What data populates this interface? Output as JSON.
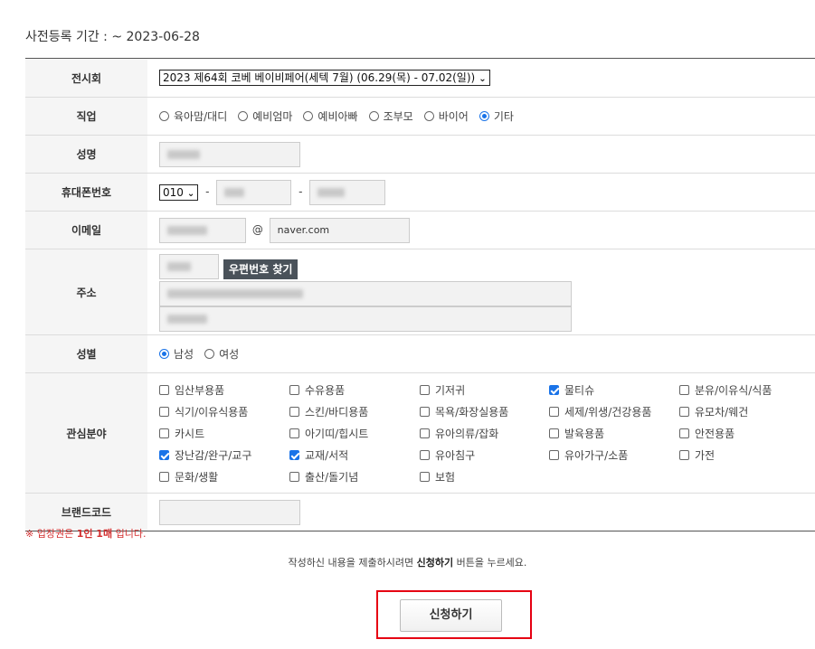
{
  "period": {
    "label": "사전등록 기간 : ~ 2023-06-28"
  },
  "rows": {
    "exhibition": {
      "label": "전시회",
      "value": "2023 제64회 코베 베이비페어(세텍 7월) (06.29(목) - 07.02(일))"
    },
    "job": {
      "label": "직업",
      "options": [
        "육아맘/대디",
        "예비엄마",
        "예비아빠",
        "조부모",
        "바이어",
        "기타"
      ],
      "selected": "기타"
    },
    "name": {
      "label": "성명"
    },
    "phone": {
      "label": "휴대폰번호",
      "prefix": "010",
      "sep1": "-",
      "sep2": "-"
    },
    "email": {
      "label": "이메일",
      "at": "@",
      "domain": "naver.com"
    },
    "address": {
      "label": "주소",
      "zip_button": "우편번호 찾기"
    },
    "gender": {
      "label": "성별",
      "options": [
        "남성",
        "여성"
      ],
      "selected": "남성"
    },
    "interest": {
      "label": "관심분야",
      "items": [
        {
          "label": "임산부용품",
          "checked": false
        },
        {
          "label": "수유용품",
          "checked": false
        },
        {
          "label": "기저귀",
          "checked": false
        },
        {
          "label": "물티슈",
          "checked": true
        },
        {
          "label": "분유/이유식/식품",
          "checked": false
        },
        {
          "label": "식기/이유식용품",
          "checked": false
        },
        {
          "label": "스킨/바디용품",
          "checked": false
        },
        {
          "label": "목욕/화장실용품",
          "checked": false
        },
        {
          "label": "세제/위생/건강용품",
          "checked": false
        },
        {
          "label": "유모차/웨건",
          "checked": false
        },
        {
          "label": "카시트",
          "checked": false
        },
        {
          "label": "아기띠/힙시트",
          "checked": false
        },
        {
          "label": "유아의류/잡화",
          "checked": false
        },
        {
          "label": "발육용품",
          "checked": false
        },
        {
          "label": "안전용품",
          "checked": false
        },
        {
          "label": "장난감/완구/교구",
          "checked": true
        },
        {
          "label": "교재/서적",
          "checked": true
        },
        {
          "label": "유아침구",
          "checked": false
        },
        {
          "label": "유아가구/소품",
          "checked": false
        },
        {
          "label": "가전",
          "checked": false
        },
        {
          "label": "문화/생활",
          "checked": false
        },
        {
          "label": "출산/돌기념",
          "checked": false
        },
        {
          "label": "보험",
          "checked": false
        }
      ]
    },
    "brandcode": {
      "label": "브랜드코드"
    }
  },
  "notice": {
    "prefix": "※ 입장권은 ",
    "bold": "1인 1매",
    "suffix": " 입니다."
  },
  "guide": {
    "prefix": "작성하신 내용을 제출하시려면 ",
    "bold": "신청하기",
    "suffix": " 버튼을 누르세요."
  },
  "submit": {
    "label": "신청하기"
  },
  "colors": {
    "accent": "#1a73e8",
    "highlight": "#e60012",
    "notice": "#d32f2f",
    "zip_button_bg": "#4a525a"
  }
}
